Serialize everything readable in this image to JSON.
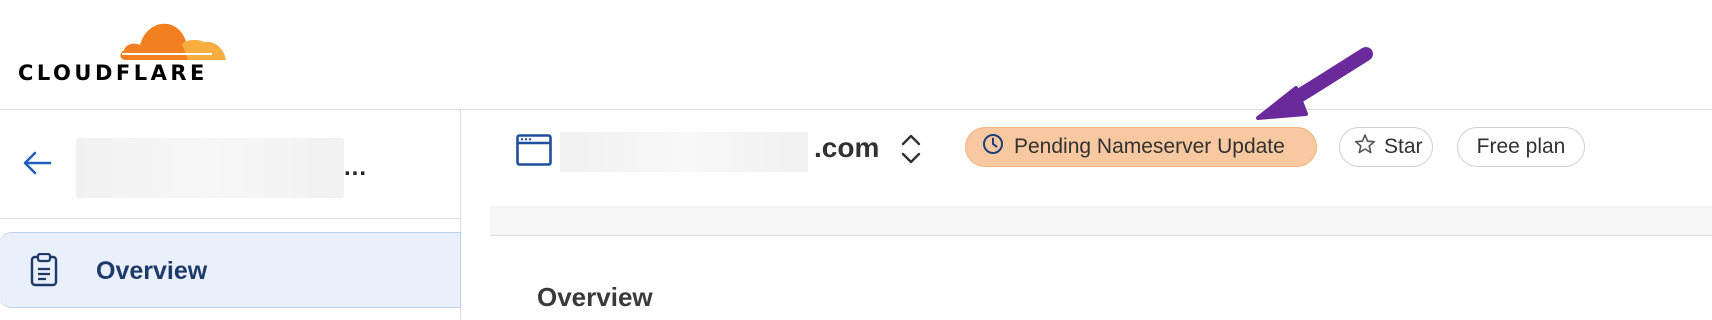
{
  "brand": {
    "name": "CLOUDFLARE",
    "cloud_colors": [
      "#f38020",
      "#faae40"
    ]
  },
  "sidebar": {
    "back_icon": "arrow-left-icon",
    "account_suffix": "...",
    "items": [
      {
        "label": "Overview",
        "icon": "clipboard-icon",
        "active": true
      }
    ]
  },
  "header": {
    "site_icon": "browser-window-icon",
    "domain_suffix": ".com",
    "switcher_icon": "chevron-up-down-icon",
    "status": {
      "label": "Pending Nameserver Update",
      "icon": "clock-icon",
      "color": "#f8c9a0"
    },
    "star": {
      "label": "Star",
      "icon": "star-outline-icon"
    },
    "plan": {
      "label": "Free plan"
    }
  },
  "main": {
    "title": "Overview"
  },
  "annotation": {
    "type": "arrow",
    "color": "#6a2a9c"
  }
}
